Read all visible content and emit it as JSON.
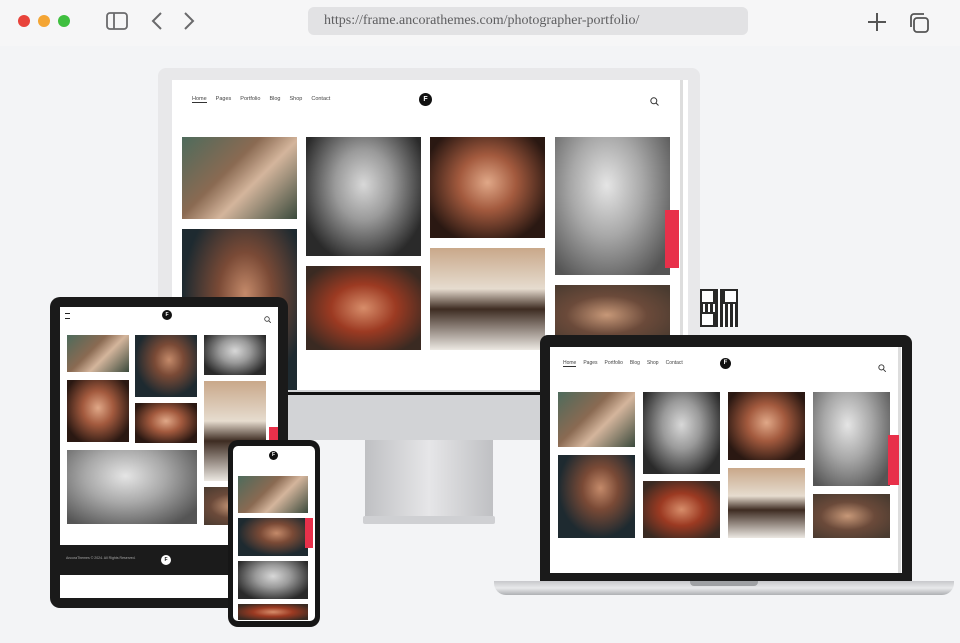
{
  "browser": {
    "url": "https://frame.ancorathemes.com/photographer-portfolio/",
    "traffic_colors": [
      "#e8433b",
      "#f4a534",
      "#3fbf3f"
    ]
  },
  "site": {
    "nav": [
      "Home",
      "Pages",
      "Portfolio",
      "Blog",
      "Shop",
      "Contact"
    ],
    "logo_letter": "F",
    "footer_text": "AncoraThemes © 2024. All Rights Reserved.",
    "accent": "#e8304a"
  }
}
